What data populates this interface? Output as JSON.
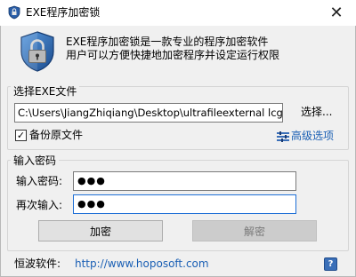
{
  "window": {
    "title": "EXE程序加密锁",
    "close_glyph": "✕"
  },
  "header": {
    "icon": "shield-lock-icon",
    "line1": "EXE程序加密锁是一款专业的程序加密软件",
    "line2": "用户可以方便快捷地加密程序并设定运行权限"
  },
  "file_group": {
    "title": "选择EXE文件",
    "path_value": "C:\\Users\\JiangZhiqiang\\Desktop\\ultrafileexternal lcg专用",
    "browse_label": "选择...",
    "backup_checked": true,
    "backup_label": "备份原文件",
    "advanced_label": "高级选项"
  },
  "password_group": {
    "title": "输入密码",
    "password_label": "输入密码:",
    "password_value": "●●●",
    "confirm_label": "再次输入:",
    "confirm_value": "●●●"
  },
  "buttons": {
    "encrypt": "加密",
    "decrypt": "解密"
  },
  "footer": {
    "label": "恒波软件:",
    "link": "http://www.hoposoft.com",
    "help": "?"
  },
  "colors": {
    "link": "#1a5fb4",
    "help": "#3a6fb8"
  }
}
